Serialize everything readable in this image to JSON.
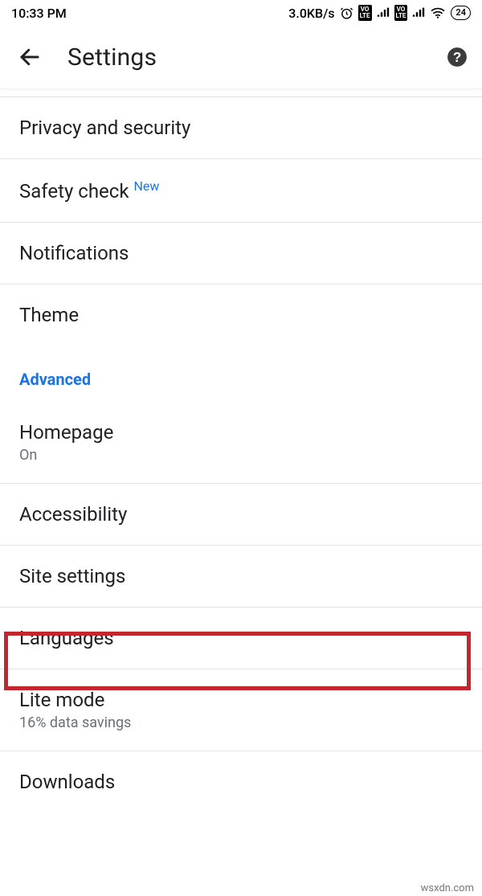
{
  "status": {
    "time": "10:33 PM",
    "net_speed": "3.0KB/s",
    "battery": "24"
  },
  "header": {
    "title": "Settings"
  },
  "items": {
    "privacy": {
      "label": "Privacy and security"
    },
    "safety": {
      "label": "Safety check",
      "badge": "New"
    },
    "notifications": {
      "label": "Notifications"
    },
    "theme": {
      "label": "Theme"
    },
    "section_advanced": "Advanced",
    "homepage": {
      "label": "Homepage",
      "sub": "On"
    },
    "accessibility": {
      "label": "Accessibility"
    },
    "site_settings": {
      "label": "Site settings"
    },
    "languages": {
      "label": "Languages"
    },
    "lite_mode": {
      "label": "Lite mode",
      "sub": "16% data savings"
    },
    "downloads": {
      "label": "Downloads"
    }
  },
  "watermark": "wsxdn.com"
}
